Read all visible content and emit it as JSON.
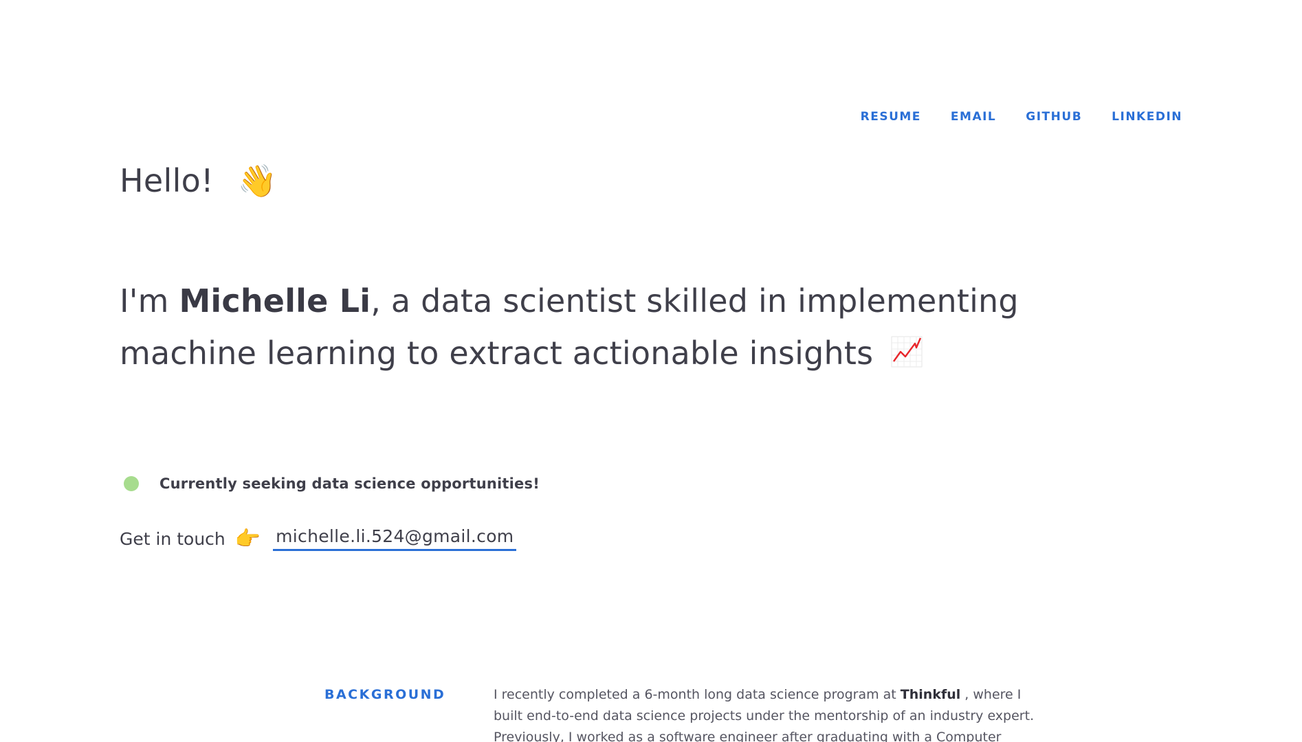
{
  "nav": {
    "items": [
      "RESUME",
      "EMAIL",
      "GITHUB",
      "LINKEDIN"
    ]
  },
  "hero": {
    "greeting": "Hello!",
    "greeting_emoji": "👋",
    "intro_prefix": "I'm ",
    "name": "Michelle Li",
    "intro_suffix": ", a data scientist skilled in implementing machine learning to extract actionable insights",
    "intro_emoji": "chart-increasing-icon"
  },
  "status": {
    "text": "Currently seeking data science opportunities!",
    "dot_color": "#a7dc8e"
  },
  "contact": {
    "label": "Get in touch",
    "emoji": "👉",
    "email": "michelle.li.524@gmail.com"
  },
  "background": {
    "label": "BACKGROUND",
    "text_before": "I recently completed a 6-month long data science program at ",
    "highlight": "Thinkful",
    "text_after": " , where I built end-to-end data science projects under the mentorship of an industry expert. Previously, I worked as a software engineer after graduating with a Computer Science degree from"
  },
  "colors": {
    "accent": "#2a6fd6",
    "text": "#3f3f4a"
  }
}
